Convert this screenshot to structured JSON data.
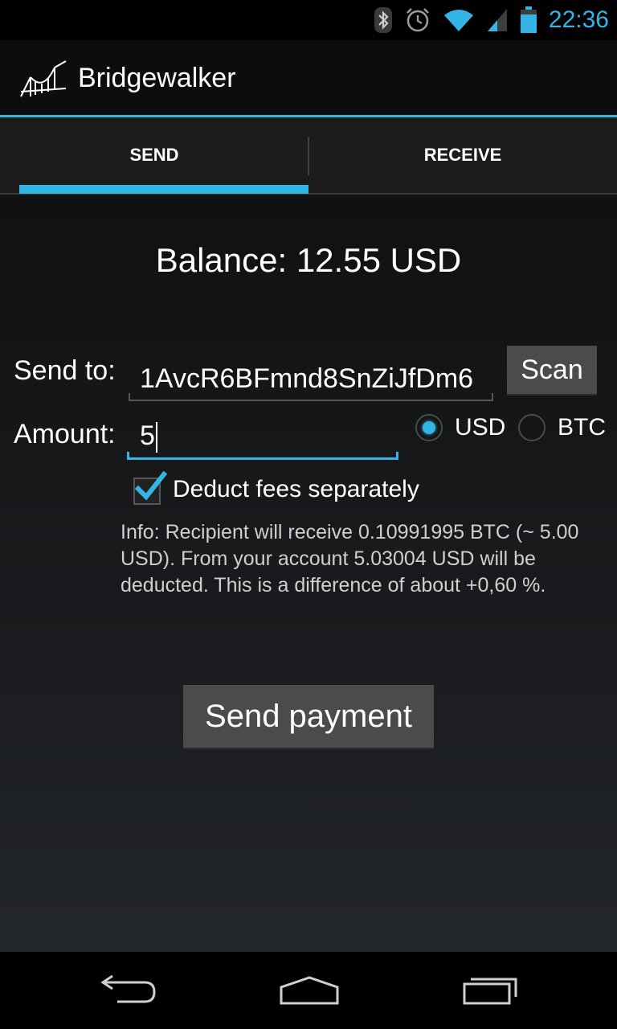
{
  "status_bar": {
    "time": "22:36",
    "icons": [
      "bluetooth-icon",
      "alarm-icon",
      "wifi-icon",
      "signal-icon",
      "battery-icon"
    ],
    "accent": "#33b5e5"
  },
  "action_bar": {
    "title": "Bridgewalker",
    "logo": "bridge-logo-icon"
  },
  "tabs": [
    {
      "label": "SEND",
      "selected": true
    },
    {
      "label": "RECEIVE",
      "selected": false
    }
  ],
  "send_form": {
    "balance": "Balance: 12.55 USD",
    "send_to_label": "Send to:",
    "send_to_value": "1AvcR6BFmnd8SnZiJfDm6",
    "scan_label": "Scan",
    "amount_label": "Amount:",
    "amount_value": "5",
    "currency_options": [
      {
        "label": "USD",
        "selected": true
      },
      {
        "label": "BTC",
        "selected": false
      }
    ],
    "deduct_fees_label": "Deduct fees separately",
    "deduct_fees_checked": true,
    "info_text": "Info: Recipient will receive 0.10991995 BTC (~ 5.00 USD). From your account 5.03004 USD will be deducted. This is a difference of about +0,60 %.",
    "send_button_label": "Send payment"
  },
  "nav_bar": {
    "buttons": [
      "back-icon",
      "home-icon",
      "recent-apps-icon"
    ]
  }
}
